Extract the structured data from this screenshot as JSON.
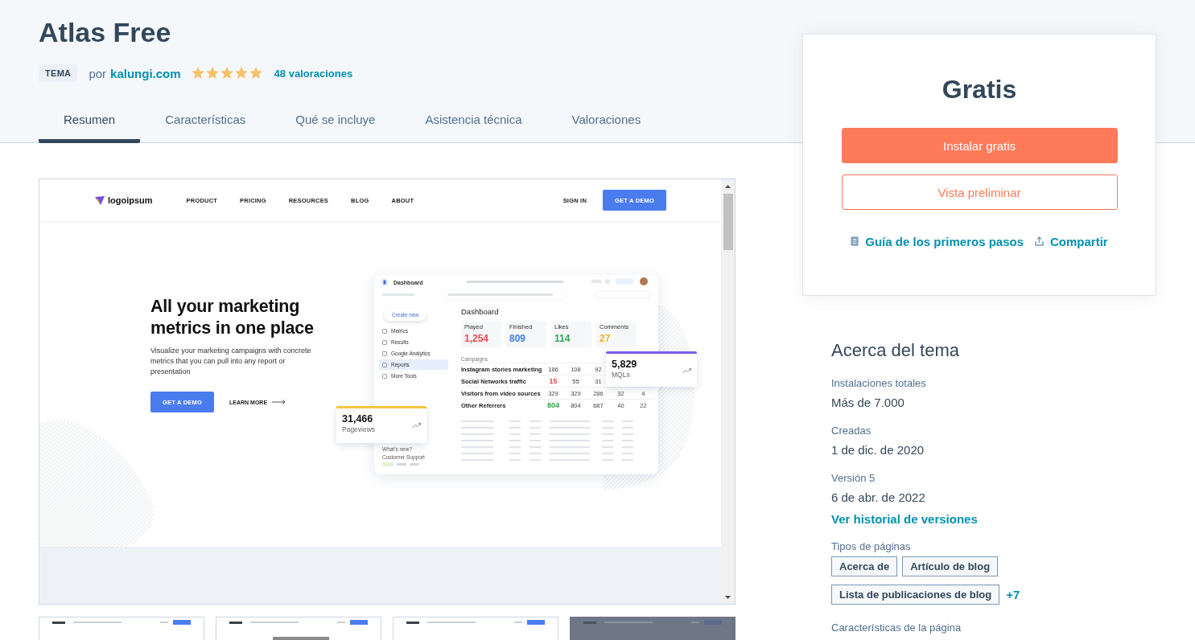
{
  "header": {
    "title": "Atlas Free",
    "type_badge": "TEMA",
    "by_prefix": "por",
    "author": "kalungi.com",
    "rating": {
      "stars": 5
    },
    "reviews_link": "48 valoraciones"
  },
  "tabs": [
    {
      "label": "Resumen",
      "selected": true
    },
    {
      "label": "Características",
      "selected": false
    },
    {
      "label": "Qué se incluye",
      "selected": false
    },
    {
      "label": "Asistencia técnica",
      "selected": false
    },
    {
      "label": "Valoraciones",
      "selected": false
    }
  ],
  "preview": {
    "nav": {
      "logo": "logoipsum",
      "links": [
        "PRODUCT",
        "PRICING",
        "RESOURCES",
        "BLOG",
        "ABOUT"
      ],
      "sign_in": "SIGN IN",
      "cta": "GET A DEMO"
    },
    "hero": {
      "heading": "All your marketing metrics in one place",
      "text": "Visualize your marketing campaigns with concrete metrics that you can pull into any report or presentation",
      "cta": "GET A DEMO",
      "link": "LEARN MORE"
    },
    "dashboard": {
      "app_title": "Dashboard",
      "create": "Create new",
      "sidebar": [
        {
          "label": "Metrics",
          "selected": false
        },
        {
          "label": "Results",
          "selected": false
        },
        {
          "label": "Google Analytics",
          "selected": false
        },
        {
          "label": "Reports",
          "selected": true
        },
        {
          "label": "More Tools",
          "selected": false
        }
      ],
      "sidebar_footer": [
        "What's new?",
        "Customer Support"
      ],
      "title": "Dashboard",
      "stats": [
        {
          "label": "Played",
          "value": "1,254",
          "color": "#e5484d"
        },
        {
          "label": "Finished",
          "value": "809",
          "color": "#3f7de8"
        },
        {
          "label": "Likes",
          "value": "114",
          "color": "#2fa84f"
        },
        {
          "label": "Comments",
          "value": "27",
          "color": "#f0b429"
        }
      ],
      "campaigns_heading": "Campaigns",
      "campaigns": [
        {
          "name": "Instagram stories marketing",
          "values": [
            "186",
            "108",
            "92"
          ]
        },
        {
          "name": "Social Networks traffic",
          "values": [
            "15",
            "55",
            "31"
          ],
          "color": "#e5484d"
        },
        {
          "name": "Visitors from video sources",
          "values": [
            "329",
            "329",
            "286",
            "32",
            "4"
          ]
        },
        {
          "name": "Other Referrers",
          "values": [
            "804",
            "804",
            "687",
            "40",
            "22"
          ],
          "color": "#2fa84f"
        }
      ]
    },
    "cards": [
      {
        "value": "31,466",
        "label": "Pageviews",
        "color": "#f5c542"
      },
      {
        "value": "5,829",
        "label": "MQLs",
        "color": "#7b5cf0"
      }
    ]
  },
  "thumbnails": [
    {
      "dimmed": false
    },
    {
      "dimmed": false
    },
    {
      "dimmed": false
    },
    {
      "dimmed": true
    }
  ],
  "pricing": {
    "price": "Gratis",
    "install": "Instalar gratis",
    "preview": "Vista preliminar",
    "links": [
      {
        "kind": "guide",
        "label": "Guía de los primeros pasos"
      },
      {
        "kind": "share",
        "label": "Compartir"
      }
    ]
  },
  "about": {
    "title": "Acerca del tema",
    "facts": [
      {
        "label": "Instalaciones totales",
        "value": "Más de 7.000"
      },
      {
        "label": "Creadas",
        "value": "1 de dic. de 2020"
      },
      {
        "label": "Versión 5",
        "value": "6 de abr. de 2022"
      }
    ],
    "history_link": "Ver historial de versiones",
    "page_types": {
      "label": "Tipos de páginas",
      "tags": [
        "Acerca de",
        "Artículo de blog",
        "Lista de publicaciones de blog"
      ],
      "more": "+7"
    },
    "features": {
      "label": "Características de la página"
    }
  }
}
